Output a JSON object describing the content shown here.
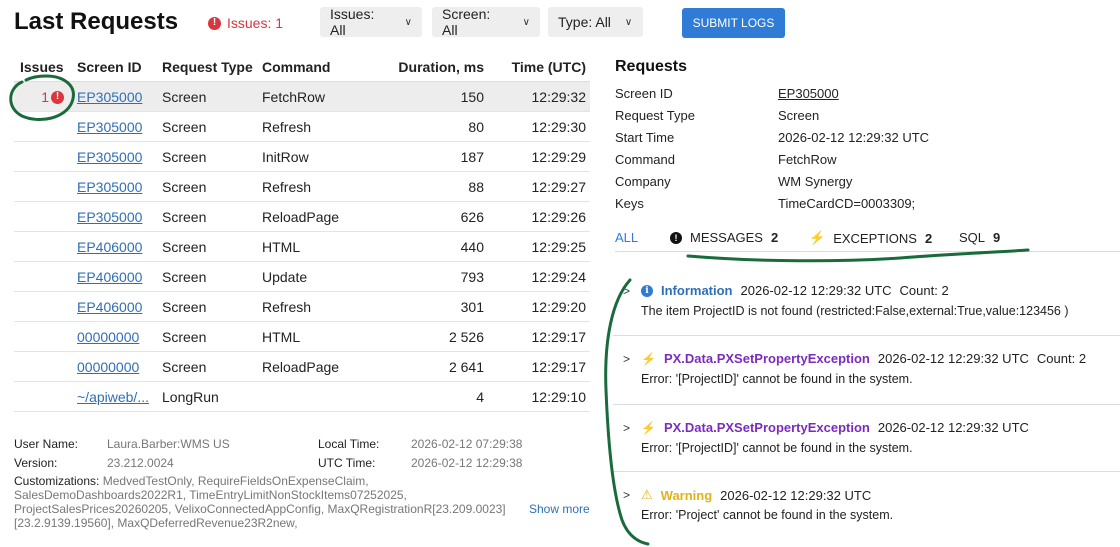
{
  "header": {
    "title": "Last Requests",
    "issues_label": "Issues: 1",
    "filters": [
      {
        "label": "Issues: All"
      },
      {
        "label": "Screen: All"
      },
      {
        "label": "Type: All"
      }
    ],
    "submit_label": "SUBMIT LOGS"
  },
  "table": {
    "columns": [
      "Issues",
      "Screen ID",
      "Request Type",
      "Command",
      "Duration, ms",
      "Time (UTC)"
    ],
    "rows": [
      {
        "issues": "1",
        "screen": "EP305000",
        "type": "Screen",
        "command": "FetchRow",
        "duration": "150",
        "time": "12:29:32"
      },
      {
        "issues": "",
        "screen": "EP305000",
        "type": "Screen",
        "command": "Refresh",
        "duration": "80",
        "time": "12:29:30"
      },
      {
        "issues": "",
        "screen": "EP305000",
        "type": "Screen",
        "command": "InitRow",
        "duration": "187",
        "time": "12:29:29"
      },
      {
        "issues": "",
        "screen": "EP305000",
        "type": "Screen",
        "command": "Refresh",
        "duration": "88",
        "time": "12:29:27"
      },
      {
        "issues": "",
        "screen": "EP305000",
        "type": "Screen",
        "command": "ReloadPage",
        "duration": "626",
        "time": "12:29:26"
      },
      {
        "issues": "",
        "screen": "EP406000",
        "type": "Screen",
        "command": "HTML",
        "duration": "440",
        "time": "12:29:25"
      },
      {
        "issues": "",
        "screen": "EP406000",
        "type": "Screen",
        "command": "Update",
        "duration": "793",
        "time": "12:29:24"
      },
      {
        "issues": "",
        "screen": "EP406000",
        "type": "Screen",
        "command": "Refresh",
        "duration": "301",
        "time": "12:29:20"
      },
      {
        "issues": "",
        "screen": "00000000",
        "type": "Screen",
        "command": "HTML",
        "duration": "2 526",
        "time": "12:29:17"
      },
      {
        "issues": "",
        "screen": "00000000",
        "type": "Screen",
        "command": "ReloadPage",
        "duration": "2 641",
        "time": "12:29:17"
      },
      {
        "issues": "",
        "screen": "~/apiweb/...",
        "type": "LongRun",
        "command": "",
        "duration": "4",
        "time": "12:29:10"
      }
    ]
  },
  "footer": {
    "user_label": "User Name:",
    "user_value": "Laura.Barber:WMS US",
    "version_label": "Version:",
    "version_value": "23.212.0024",
    "local_label": "Local Time:",
    "local_value": "2026-02-12 07:29:38",
    "utc_label": "UTC Time:",
    "utc_value": "2026-02-12 12:29:38",
    "cust_label": "Customizations:",
    "cust_value": "MedvedTestOnly, RequireFieldsOnExpenseClaim, SalesDemoDashboards2022R1, TimeEntryLimitNonStockItems07252025, ProjectSalesPrices20260205, VelixoConnectedAppConfig, MaxQRegistrationR[23.209.0023][23.2.9139.19560], MaxQDeferredRevenue23R2new,",
    "show_more": "Show more"
  },
  "details": {
    "title": "Requests",
    "fields": [
      {
        "key": "Screen ID",
        "value": "EP305000",
        "link": true
      },
      {
        "key": "Request Type",
        "value": "Screen"
      },
      {
        "key": "Start Time",
        "value": "2026-02-12 12:29:32 UTC"
      },
      {
        "key": "Command",
        "value": "FetchRow"
      },
      {
        "key": "Company",
        "value": "WM Synergy"
      },
      {
        "key": "Keys",
        "value": "TimeCardCD=0003309;"
      }
    ],
    "tabs": {
      "all": "ALL",
      "messages": "MESSAGES",
      "messages_count": "2",
      "exceptions": "EXCEPTIONS",
      "exceptions_count": "2",
      "sql": "SQL",
      "sql_count": "9"
    },
    "entries": [
      {
        "level": "Information",
        "time": "2026-02-12 12:29:32 UTC",
        "count": "Count: 2",
        "message": "The item ProjectID is not found (restricted:False,external:True,value:123456 )"
      },
      {
        "level": "PX.Data.PXSetPropertyException",
        "time": "2026-02-12 12:29:32 UTC",
        "count": "Count: 2",
        "message": "Error: '[ProjectID]' cannot be found in the system."
      },
      {
        "level": "PX.Data.PXSetPropertyException",
        "time": "2026-02-12 12:29:32 UTC",
        "count": "",
        "message": "Error: '[ProjectID]' cannot be found in the system."
      },
      {
        "level": "Warning",
        "time": "2026-02-12 12:29:32 UTC",
        "count": "",
        "message": "Error: 'Project' cannot be found in the system."
      }
    ]
  },
  "colors": {
    "accent": "#2f7bd5",
    "error": "#d9363e",
    "exception": "#7b2cbf",
    "warning": "#e2b21a",
    "annotation": "#1a6b3c"
  }
}
